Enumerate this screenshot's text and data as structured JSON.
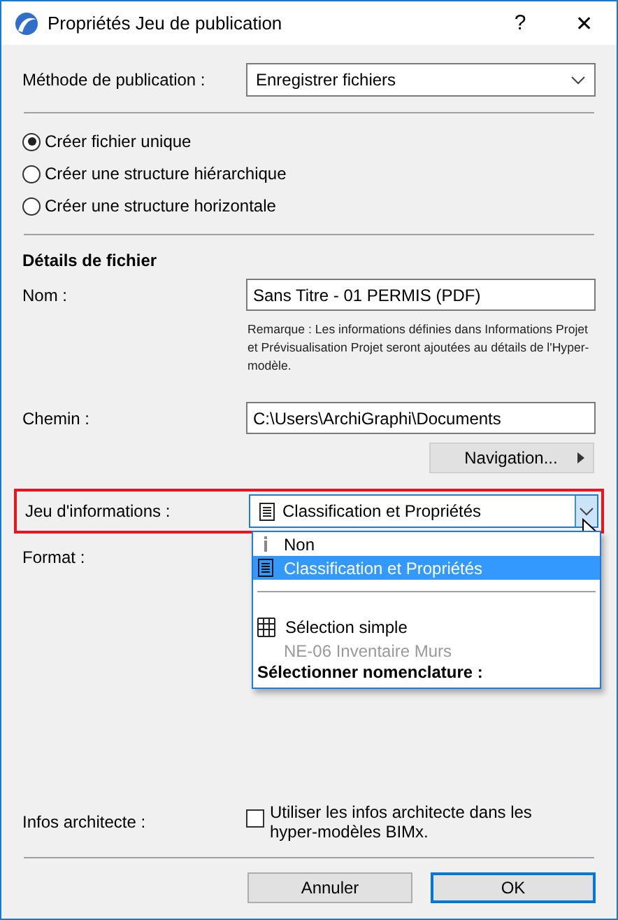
{
  "window": {
    "title": "Propriétés Jeu de publication",
    "help": "?",
    "close": "✕"
  },
  "method": {
    "label": "Méthode de publication :",
    "value": "Enregistrer fichiers"
  },
  "structure": [
    {
      "label": "Créer fichier unique",
      "selected": true
    },
    {
      "label": "Créer une structure hiérarchique",
      "selected": false
    },
    {
      "label": "Créer une structure horizontale",
      "selected": false
    }
  ],
  "file_details": {
    "heading": "Détails de fichier",
    "name_label": "Nom :",
    "name_value": "Sans Titre - 01 PERMIS (PDF)",
    "note": "Remarque : Les informations définies dans Informations Projet et Prévisualisation Projet seront ajoutées au détails de l'Hyper-modèle.",
    "path_label": "Chemin :",
    "path_value": "C:\\Users\\ArchiGraphi\\Documents",
    "browse_button": "Navigation..."
  },
  "info_set": {
    "label": "Jeu d'informations :",
    "value": "Classification et Propriétés",
    "highlighted": true,
    "expanded": true,
    "options": [
      {
        "kind": "none",
        "label": "Non",
        "selected": false
      },
      {
        "kind": "set",
        "label": "Classification et Propriétés",
        "selected": true
      },
      {
        "kind": "separator"
      },
      {
        "kind": "schedule",
        "label": "Sélection simple",
        "selected": false
      },
      {
        "kind": "schedule-entry",
        "label": "NE-06 Inventaire Murs",
        "selected": false
      },
      {
        "kind": "heading",
        "label": "Sélectionner nomenclature :"
      }
    ]
  },
  "format": {
    "label": "Format :"
  },
  "architect_info": {
    "label": "Infos architecte :",
    "option": "Utiliser les infos architecte dans les hyper-modèles BIMx.",
    "checked": false
  },
  "buttons": [
    {
      "label": "Annuler",
      "default": false
    },
    {
      "label": "OK",
      "default": true
    }
  ]
}
